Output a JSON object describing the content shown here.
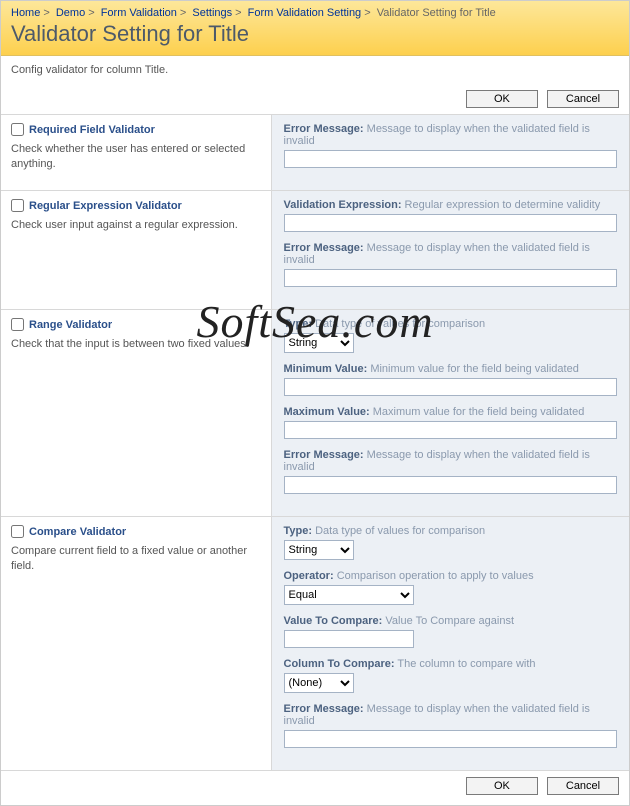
{
  "breadcrumb": {
    "items": [
      "Home",
      "Demo",
      "Form Validation",
      "Settings",
      "Form Validation Setting"
    ],
    "current": "Validator Setting for Title"
  },
  "title": "Validator Setting for Title",
  "description": "Config validator for column Title.",
  "buttons": {
    "ok": "OK",
    "cancel": "Cancel"
  },
  "watermark": "SoftSea.com",
  "sections": {
    "required": {
      "label": "Required Field Validator",
      "desc": "Check whether the user has entered or selected anything.",
      "fields": {
        "error": {
          "label": "Error Message:",
          "hint": "Message to display when the validated field is invalid",
          "value": ""
        }
      }
    },
    "regex": {
      "label": "Regular Expression Validator",
      "desc": "Check user input against a regular expression.",
      "fields": {
        "expr": {
          "label": "Validation Expression:",
          "hint": "Regular expression to determine validity",
          "value": ""
        },
        "error": {
          "label": "Error Message:",
          "hint": "Message to display when the validated field is invalid",
          "value": ""
        }
      }
    },
    "range": {
      "label": "Range Validator",
      "desc": "Check that the input is between two fixed values.",
      "fields": {
        "type": {
          "label": "Type:",
          "hint": "Data type of values for comparison",
          "value": "String"
        },
        "min": {
          "label": "Minimum Value:",
          "hint": "Minimum value for the field being validated",
          "value": ""
        },
        "max": {
          "label": "Maximum Value:",
          "hint": "Maximum value for the field being validated",
          "value": ""
        },
        "error": {
          "label": "Error Message:",
          "hint": "Message to display when the validated field is invalid",
          "value": ""
        }
      }
    },
    "compare": {
      "label": "Compare Validator",
      "desc": "Compare current field to a fixed value or another field.",
      "fields": {
        "type": {
          "label": "Type:",
          "hint": "Data type of values for comparison",
          "value": "String"
        },
        "operator": {
          "label": "Operator:",
          "hint": "Comparison operation to apply to values",
          "value": "Equal"
        },
        "valueToCompare": {
          "label": "Value To Compare:",
          "hint": "Value To Compare against",
          "value": ""
        },
        "columnToCompare": {
          "label": "Column To Compare:",
          "hint": "The column to compare with",
          "value": "(None)"
        },
        "error": {
          "label": "Error Message:",
          "hint": "Message to display when the validated field is invalid",
          "value": ""
        }
      }
    }
  }
}
